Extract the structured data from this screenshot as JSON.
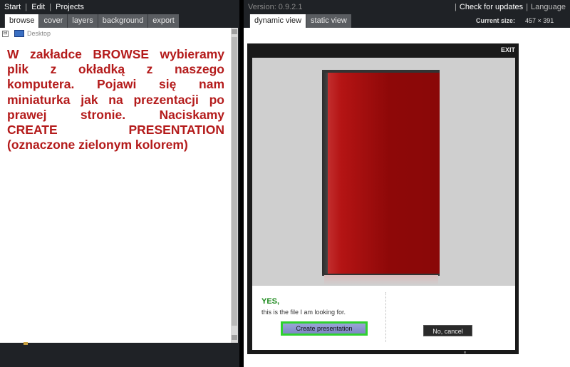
{
  "menu": {
    "start": "Start",
    "edit": "Edit",
    "projects": "Projects"
  },
  "left_tabs": [
    "browse",
    "cover",
    "layers",
    "background",
    "export"
  ],
  "tree": {
    "expander": "⊟",
    "desktop_label": "Desktop"
  },
  "instruction_lines": [
    "W zakładce BROWSE wybieramy",
    "plik z okładką z naszego",
    "komputera. Pojawi się nam",
    "miniaturka jak na prezentacji po",
    "prawej stronie. Naciskamy",
    "CREATE PRESENTATION",
    "(oznaczone zielonym kolorem)"
  ],
  "version": "Version: 0.9.2.1",
  "top_links": {
    "updates": "Check for updates",
    "language": "Language"
  },
  "right_tabs": [
    "dynamic view",
    "static view"
  ],
  "current_size": {
    "label": "Current size:",
    "value": "457 × 391"
  },
  "dialog": {
    "exit": "EXIT",
    "yes": "YES,",
    "confirm_text": "this is the file I am looking for.",
    "create_button": "Create presentation",
    "cancel_button": "No, cancel"
  },
  "colors": {
    "instruction_text": "#b41b1b",
    "yes_text": "#1d8a1d",
    "highlight": "#2fd22f",
    "box_red": "#b41414"
  }
}
